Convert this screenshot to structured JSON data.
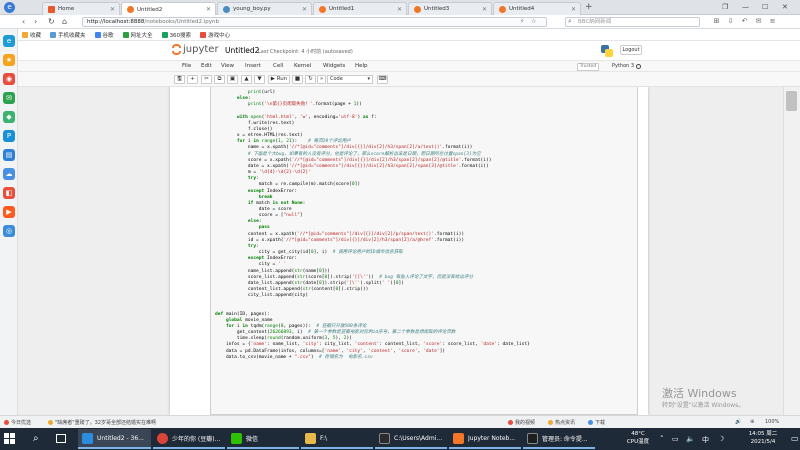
{
  "browser": {
    "tabs": [
      {
        "label": "Home",
        "icon": "home-icon",
        "active": false
      },
      {
        "label": "Untitled2",
        "icon": "jupyter-icon",
        "active": true
      },
      {
        "label": "young_boy.py",
        "icon": "python-file-icon",
        "active": false
      },
      {
        "label": "Untitled1",
        "icon": "jupyter-icon",
        "active": false
      },
      {
        "label": "Untitled3",
        "icon": "jupyter-icon",
        "active": false
      },
      {
        "label": "Untitled4",
        "icon": "jupyter-icon",
        "active": false
      }
    ],
    "new_tab": "+",
    "url_host": "http://localhost:8888",
    "url_path": "/notebooks/Untitled2.ipynb",
    "search_placeholder": "BBC納网新闻",
    "bookmarks": [
      {
        "label": "收藏",
        "color": "#f0a830"
      },
      {
        "label": "手机收藏夹",
        "color": "#5b9bd5"
      },
      {
        "label": "谷歌",
        "color": "#4285f4"
      },
      {
        "label": "网址大全",
        "color": "#2ea043"
      },
      {
        "label": "360搜索",
        "color": "#19a15f"
      },
      {
        "label": "游戏中心",
        "color": "#e84c3d"
      }
    ]
  },
  "jupyter": {
    "logo_text": "jupyter",
    "title": "Untitled2",
    "checkpoint": "Last Checkpoint: 4 小时前   (autosaved)",
    "logout": "Logout",
    "menus": [
      "File",
      "Edit",
      "View",
      "Insert",
      "Cell",
      "Kernel",
      "Widgets",
      "Help"
    ],
    "trusted": "Trusted",
    "kernel": "Python 3",
    "run_label": "Run",
    "cell_type": "Code"
  },
  "code_lines": [
    "            print(url)",
    "        else:",
    "            print('\\n第{}页爬取失败！'.format(page + 1))",
    "",
    "        with open('html.html', 'w', encoding='utf-8') as f:",
    "            f.write(res.text)",
    "            f.close()",
    "        x = etree.HTML(res.text)",
    "        for i in range(1, 21):    # 每页20个评论用户",
    "            name = x.xpath('//*[@id=\"comments\"]/div[{}]/div[2]/h3/span[2]/a/text()'.format(i))",
    "            # 下面是个大bug，如果有的人没有评分，他是评论了，那么score解析出来是日期，而日期所在位置span[3]为空",
    "            score = x.xpath('//*[@id=\"comments\"]/div[{}]/div[2]/h3/span[2]/span[2]/@title'.format(i))",
    "            date = x.xpath('//*[@id=\"comments\"]/div[{}]/div[2]/h3/span[2]/span[3]/@title'.format(i))",
    "            m = '\\d{4}-\\d{2}-\\d{2}'",
    "            try:",
    "                match = re.compile(m).match(score[0])",
    "            except IndexError:",
    "                break",
    "            if match is not None:",
    "                date = score",
    "                score = [\"null\"]",
    "            else:",
    "                pass",
    "            content = x.xpath('//*[@id=\"comments\"]/div[{}]/div[2]/p/span/text()'.format(i))",
    "            id = x.xpath('//*[@id=\"comments\"]/div[{}]/div[2]/h3/span[2]/a/@href'.format(i))",
    "            try:",
    "                city = get_city(id[0], i)  # 调用评论用户的ID城市信息获取",
    "            except IndexError:",
    "                city = ' '",
    "            name_list.append(str(name[0]))",
    "            score_list.append(str(score[0]).strip('[]\\''))  # bug 有些人评论了文字，但是没有给出评分",
    "            date_list.append(str(date[0]).strip('[\\'').split(' ')[0])",
    "            content_list.append(str(content[0]).strip())",
    "            city_list.append(city)",
    "",
    "",
    "def main(ID, pages):",
    "    global movie_name",
    "    for i in tqdm(range(0, pages)):  # 豆瓣只开放500条评论",
    "        get_content(26266893, i)  # 第一个参数是豆瓣电影对应的id序号，第二个参数是想爬取的评论页数",
    "        time.sleep(round(random.uniform(3, 5), 2))",
    "    infos = {'name': name_list, 'city': city_list, 'content': content_list, 'score': score_list, 'date': date_list}",
    "    data = pd.DataFrame(infos, columns=['name', 'city', 'content', 'score', 'date'])",
    "    data.to_csv(movie_name + \".csv\")  # 存储名为  电影名.csv"
  ],
  "watermark": {
    "title": "激活 Windows",
    "subtitle": "转到\"设置\"以激活 Windows。"
  },
  "statusbar": {
    "left1": "今日优选",
    "left2": "\"缺席者\"重磅了，32岁哥全部还结婚实在难啊",
    "right_items": [
      "我的视频",
      "热点资讯",
      "下载",
      "",
      "",
      "100%"
    ]
  },
  "taskbar": {
    "apps": [
      {
        "label": "Untitled2 - 36...",
        "color": "#2a8de0",
        "active": true
      },
      {
        "label": "少年的你 (豆瓣)...",
        "color": "#db4437",
        "active": false
      },
      {
        "label": "微信",
        "color": "#2dc100",
        "active": false
      },
      {
        "label": "F:\\",
        "color": "#e8b84a",
        "active": false
      },
      {
        "label": "C:\\Users\\Admi...",
        "color": "#2b2b2b",
        "active": false
      },
      {
        "label": "Jupyter Noteb...",
        "color": "#f37726",
        "active": false
      },
      {
        "label": "管理员: 命令提...",
        "color": "#1e1e1e",
        "active": false
      }
    ],
    "weather_temp": "48°C",
    "weather_label": "CPU温度",
    "time": "14:05 周二",
    "date": "2021/5/4"
  }
}
